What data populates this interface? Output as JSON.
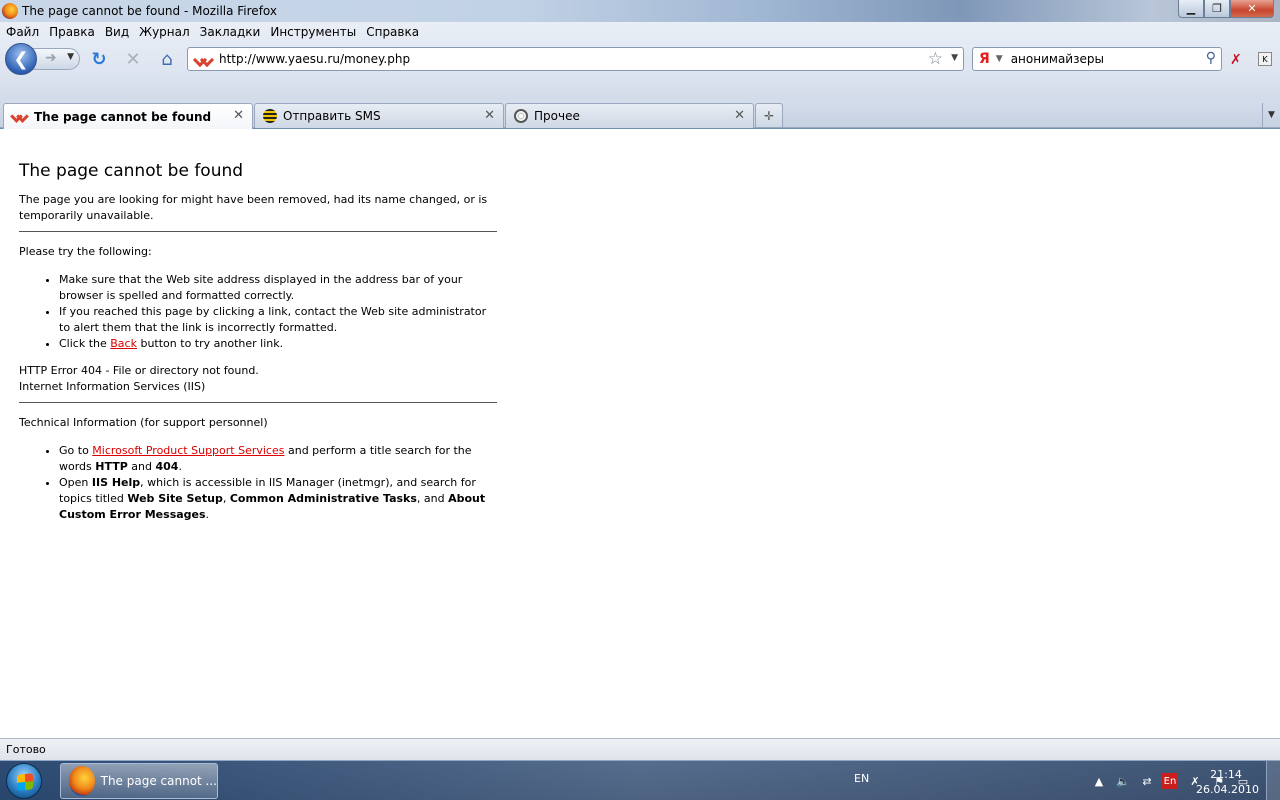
{
  "window": {
    "title": "The page cannot be found - Mozilla Firefox"
  },
  "menu": [
    "Файл",
    "Правка",
    "Вид",
    "Журнал",
    "Закладки",
    "Инструменты",
    "Справка"
  ],
  "nav": {
    "url": "http://www.yaesu.ru/money.php",
    "search_value": "анонимайзеры",
    "search_engine": "Я"
  },
  "tabs": [
    {
      "label": "The page cannot be found",
      "active": true,
      "icon": "site-icon"
    },
    {
      "label": "Отправить SMS",
      "active": false,
      "icon": "beeline-icon"
    },
    {
      "label": "Прочее",
      "active": false,
      "icon": "globe-icon"
    }
  ],
  "page": {
    "heading": "The page cannot be found",
    "intro": "The page you are looking for might have been removed, had its name changed, or is temporarily unavailable.",
    "try_following": "Please try the following:",
    "bullets": {
      "b1": "Make sure that the Web site address displayed in the address bar of your browser is spelled and formatted correctly.",
      "b2": "If you reached this page by clicking a link, contact the Web site administrator to alert them that the link is incorrectly formatted.",
      "b3_pre": "Click the ",
      "b3_link": "Back",
      "b3_post": " button to try another link."
    },
    "error_line1": "HTTP Error 404 - File or directory not found.",
    "error_line2": "Internet Information Services (IIS)",
    "tech_heading": "Technical Information (for support personnel)",
    "tech": {
      "t1_pre": "Go to ",
      "t1_link": "Microsoft Product Support Services",
      "t1_mid": " and perform a title search for the words ",
      "t1_b1": "HTTP",
      "t1_and": " and ",
      "t1_b2": "404",
      "t1_end": ".",
      "t2_pre": "Open ",
      "t2_b1": "IIS Help",
      "t2_mid": ", which is accessible in IIS Manager (inetmgr), and search for topics titled ",
      "t2_b2": "Web Site Setup",
      "t2_comma": ", ",
      "t2_b3": "Common Administrative Tasks",
      "t2_and": ", and ",
      "t2_b4": "About Custom Error Messages",
      "t2_end": "."
    }
  },
  "status": "Готово",
  "taskbar": {
    "task_label": "The page cannot ...",
    "lang": "EN",
    "tray_en": "En",
    "time": "21:14",
    "date": "26.04.2010"
  },
  "colors": {
    "link": "#dd0000",
    "accent": "#2e5fb3"
  }
}
